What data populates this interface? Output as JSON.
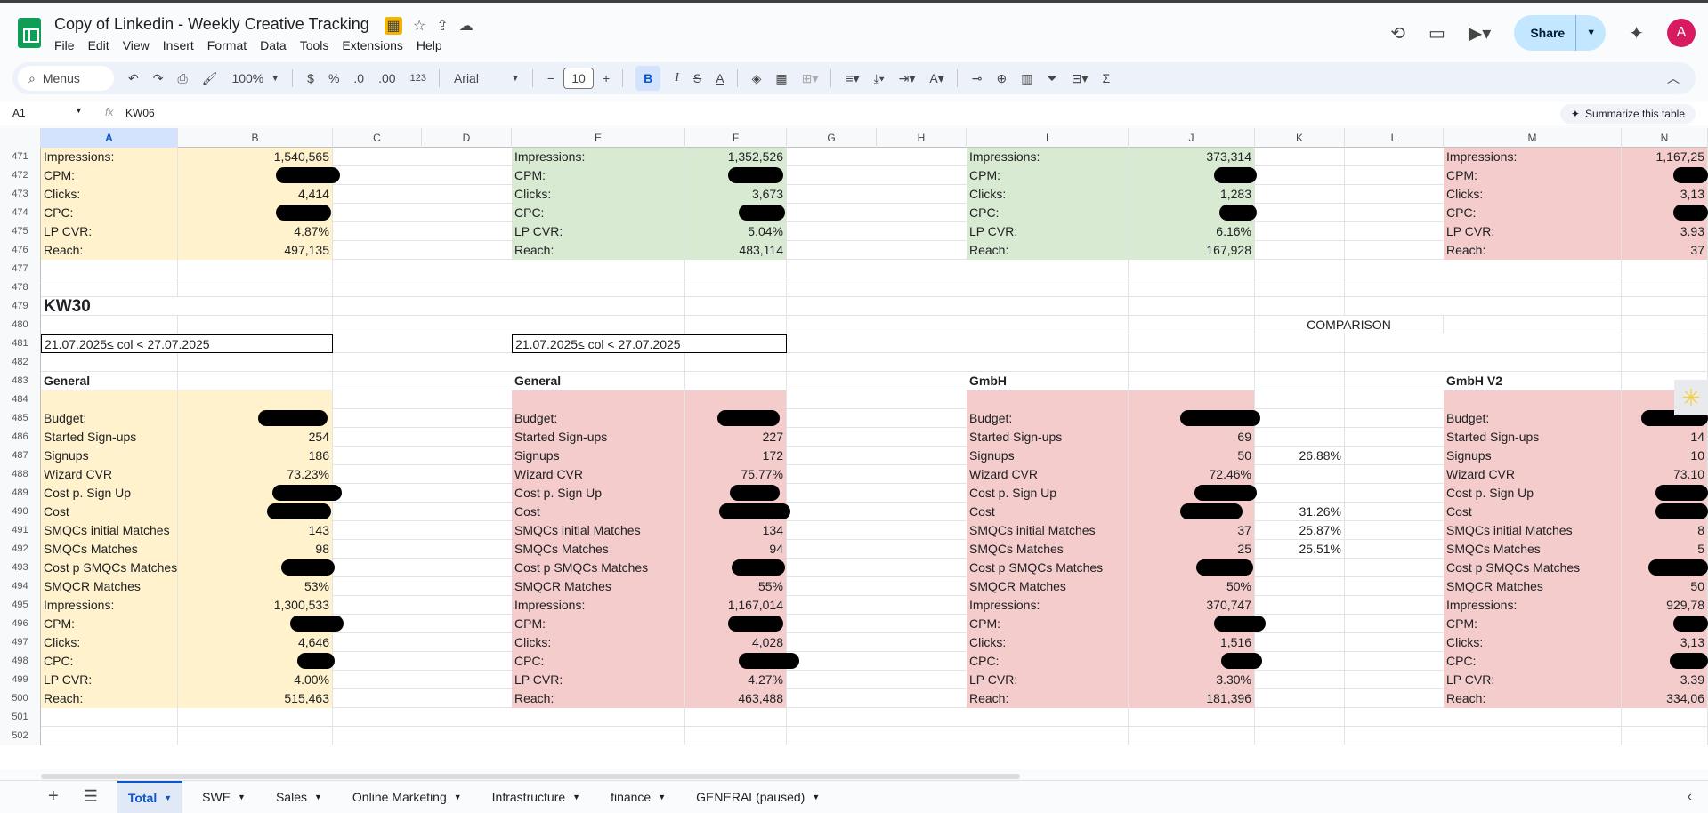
{
  "header": {
    "title": "Copy of Linkedin - Weekly Creative Tracking",
    "menus": [
      "File",
      "Edit",
      "View",
      "Insert",
      "Format",
      "Data",
      "Tools",
      "Extensions",
      "Help"
    ],
    "share_label": "Share",
    "avatar_letter": "A"
  },
  "toolbar": {
    "search_label": "Menus",
    "zoom": "100%",
    "currency": "$",
    "percent": "%",
    "dec_less": ".0",
    "dec_more": ".00",
    "number_format": "123",
    "font": "Arial",
    "font_size": "10",
    "bold": "B",
    "italic": "I"
  },
  "formula": {
    "cell_ref": "A1",
    "fx": "fx",
    "value": "KW06",
    "summarize": "Summarize this table"
  },
  "columns": [
    "A",
    "B",
    "C",
    "D",
    "E",
    "F",
    "G",
    "H",
    "I",
    "J",
    "K",
    "L",
    "M",
    "N"
  ],
  "rows": {
    "r471": {
      "n": "471",
      "a": "Impressions:",
      "b": "1,540,565",
      "e": "Impressions:",
      "f": "1,352,526",
      "i": "Impressions:",
      "j": "373,314",
      "m": "Impressions:",
      "nn": "1,167,25"
    },
    "r472": {
      "n": "472",
      "a": "CPM:",
      "e": "CPM:",
      "i": "CPM:",
      "m": "CPM:"
    },
    "r473": {
      "n": "473",
      "a": "Clicks:",
      "b": "4,414",
      "e": "Clicks:",
      "f": "3,673",
      "i": "Clicks:",
      "j": "1,283",
      "m": "Clicks:",
      "nn": "3,13"
    },
    "r474": {
      "n": "474",
      "a": "CPC:",
      "e": "CPC:",
      "i": "CPC:",
      "m": "CPC:"
    },
    "r475": {
      "n": "475",
      "a": "LP CVR:",
      "b": "4.87%",
      "e": "LP CVR:",
      "f": "5.04%",
      "i": "LP CVR:",
      "j": "6.16%",
      "m": "LP CVR:",
      "nn": "3.93"
    },
    "r476": {
      "n": "476",
      "a": "Reach:",
      "b": "497,135",
      "e": "Reach:",
      "f": "483,114",
      "i": "Reach:",
      "j": "167,928",
      "m": "Reach:",
      "nn": "37"
    },
    "r477": {
      "n": "477"
    },
    "r478": {
      "n": "478"
    },
    "r479": {
      "n": "479",
      "a": "KW30"
    },
    "r480": {
      "n": "480",
      "k": "COMPARISON"
    },
    "r481": {
      "n": "481",
      "a": "21.07.2025≤ col < 27.07.2025",
      "e": "21.07.2025≤ col < 27.07.2025"
    },
    "r482": {
      "n": "482"
    },
    "r483": {
      "n": "483",
      "a": "General",
      "e": "General",
      "i": "GmbH",
      "m": "GmbH V2"
    },
    "r484": {
      "n": "484"
    },
    "r485": {
      "n": "485",
      "a": "Budget:",
      "e": "Budget:",
      "i": "Budget:",
      "m": "Budget:"
    },
    "r486": {
      "n": "486",
      "a": "Started Sign-ups",
      "b": "254",
      "e": "Started Sign-ups",
      "f": "227",
      "i": "Started Sign-ups",
      "j": "69",
      "m": "Started Sign-ups",
      "nn": "14"
    },
    "r487": {
      "n": "487",
      "a": "Signups",
      "b": "186",
      "e": "Signups",
      "f": "172",
      "i": "Signups",
      "j": "50",
      "k": "26.88%",
      "m": "Signups",
      "nn": "10"
    },
    "r488": {
      "n": "488",
      "a": "Wizard CVR",
      "b": "73.23%",
      "e": "Wizard CVR",
      "f": "75.77%",
      "i": "Wizard CVR",
      "j": "72.46%",
      "m": "Wizard CVR",
      "nn": "73.10"
    },
    "r489": {
      "n": "489",
      "a": "Cost p. Sign Up",
      "e": "Cost p. Sign Up",
      "i": "Cost p. Sign Up",
      "m": "Cost p. Sign Up"
    },
    "r490": {
      "n": "490",
      "a": "Cost",
      "e": "Cost",
      "i": "Cost",
      "k": "31.26%",
      "m": "Cost"
    },
    "r491": {
      "n": "491",
      "a": "SMQCs initial Matches",
      "b": "143",
      "e": "SMQCs initial Matches",
      "f": "134",
      "i": "SMQCs initial Matches",
      "j": "37",
      "k": "25.87%",
      "m": "SMQCs initial Matches",
      "nn": "8"
    },
    "r492": {
      "n": "492",
      "a": "SMQCs Matches",
      "b": "98",
      "e": "SMQCs Matches",
      "f": "94",
      "i": "SMQCs Matches",
      "j": "25",
      "k": "25.51%",
      "m": "SMQCs Matches",
      "nn": "5"
    },
    "r493": {
      "n": "493",
      "a": "Cost p SMQCs Matches",
      "e": "Cost p SMQCs Matches",
      "i": "Cost p SMQCs Matches",
      "m": "Cost p SMQCs Matches"
    },
    "r494": {
      "n": "494",
      "a": "SMQCR Matches",
      "b": "53%",
      "e": "SMQCR Matches",
      "f": "55%",
      "i": "SMQCR Matches",
      "j": "50%",
      "m": "SMQCR Matches",
      "nn": "50"
    },
    "r495": {
      "n": "495",
      "a": "Impressions:",
      "b": "1,300,533",
      "e": "Impressions:",
      "f": "1,167,014",
      "i": "Impressions:",
      "j": "370,747",
      "m": "Impressions:",
      "nn": "929,78"
    },
    "r496": {
      "n": "496",
      "a": "CPM:",
      "e": "CPM:",
      "i": "CPM:",
      "m": "CPM:"
    },
    "r497": {
      "n": "497",
      "a": "Clicks:",
      "b": "4,646",
      "e": "Clicks:",
      "f": "4,028",
      "i": "Clicks:",
      "j": "1,516",
      "m": "Clicks:",
      "nn": "3,13"
    },
    "r498": {
      "n": "498",
      "a": "CPC:",
      "e": "CPC:",
      "i": "CPC:",
      "m": "CPC:"
    },
    "r499": {
      "n": "499",
      "a": "LP CVR:",
      "b": "4.00%",
      "e": "LP CVR:",
      "f": "4.27%",
      "i": "LP CVR:",
      "j": "3.30%",
      "m": "LP CVR:",
      "nn": "3.39"
    },
    "r500": {
      "n": "500",
      "a": "Reach:",
      "b": "515,463",
      "e": "Reach:",
      "f": "463,488",
      "i": "Reach:",
      "j": "181,396",
      "m": "Reach:",
      "nn": "334,06"
    },
    "r501": {
      "n": "501"
    },
    "r502": {
      "n": "502"
    }
  },
  "sheets": [
    "Total",
    "SWE",
    "Sales",
    "Online Marketing",
    "Infrastructure",
    "finance",
    "GENERAL(paused)"
  ],
  "colors": {
    "yellow": "#fff2cc",
    "green": "#d9ead3",
    "pink": "#f4cccc",
    "accent": "#0b57d0"
  }
}
